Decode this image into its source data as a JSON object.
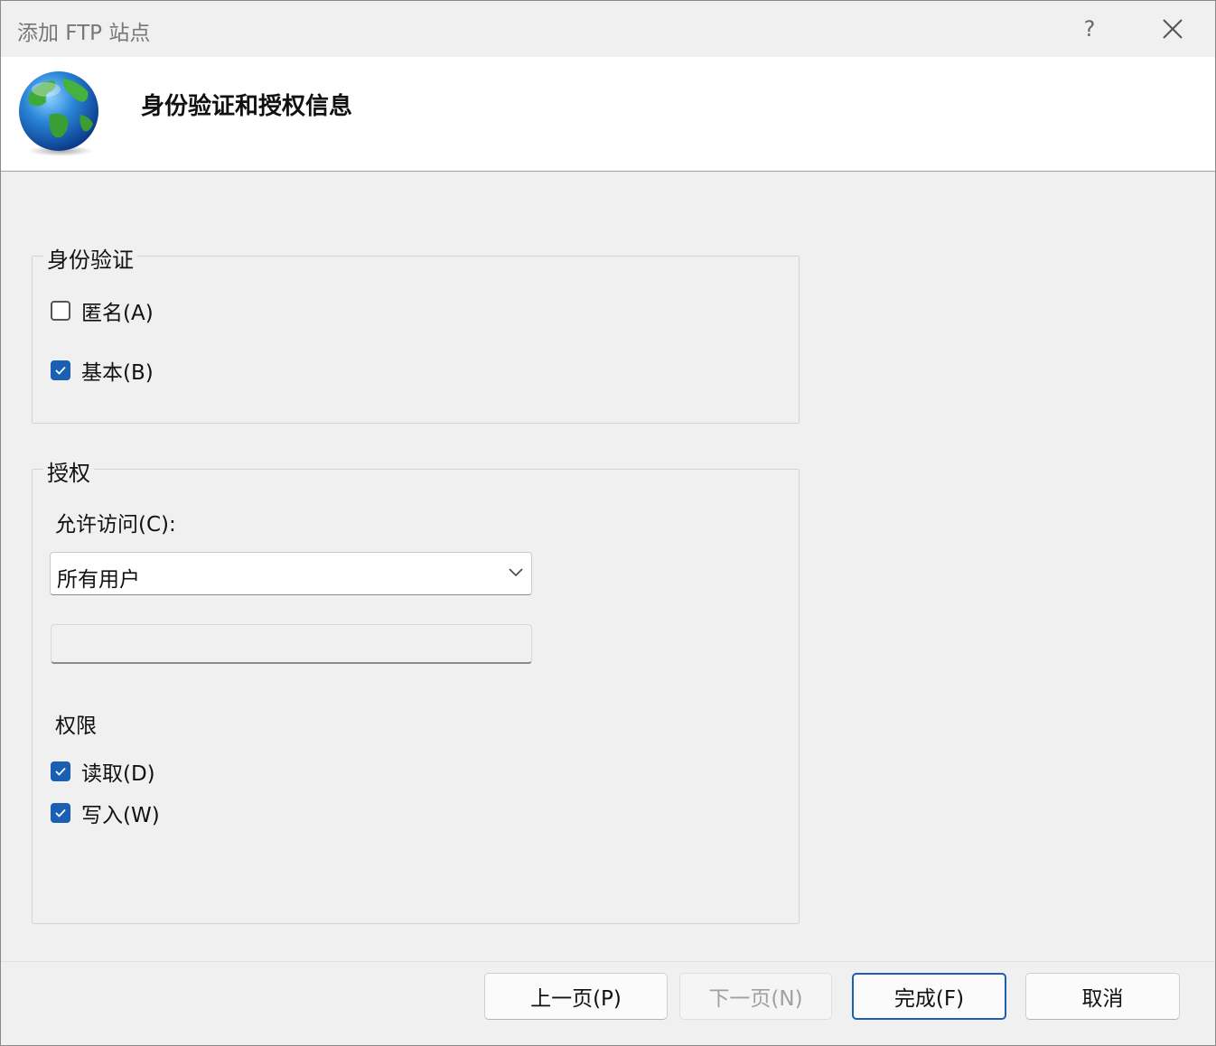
{
  "window": {
    "title": "添加 FTP 站点",
    "help_label": "?"
  },
  "header": {
    "title": "身份验证和授权信息",
    "icon": "globe-icon"
  },
  "authentication": {
    "legend": "身份验证",
    "options": [
      {
        "label": "匿名(A)",
        "checked": false
      },
      {
        "label": "基本(B)",
        "checked": true
      }
    ]
  },
  "authorization": {
    "legend": "授权",
    "allow_access_label": "允许访问(C):",
    "allow_access_value": "所有用户",
    "users_input_value": "",
    "permissions_label": "权限",
    "permissions": [
      {
        "label": "读取(D)",
        "checked": true
      },
      {
        "label": "写入(W)",
        "checked": true
      }
    ]
  },
  "buttons": {
    "prev": "上一页(P)",
    "next": "下一页(N)",
    "finish": "完成(F)",
    "cancel": "取消"
  },
  "colors": {
    "accent": "#1a5fb4",
    "background": "#f0f0f0"
  }
}
